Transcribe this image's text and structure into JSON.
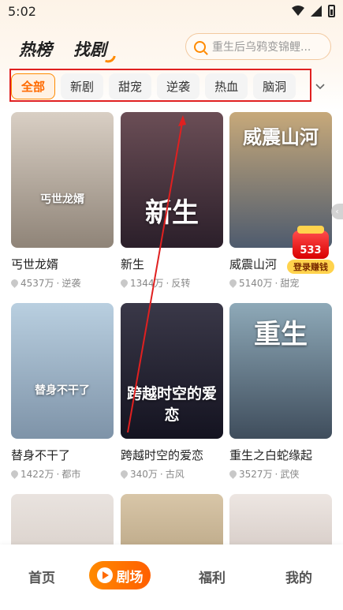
{
  "status_bar": {
    "time": "5:02"
  },
  "header": {
    "tab_hot": "热榜",
    "tab_find": "找剧",
    "search_placeholder": "重生后乌鸦变锦鲤..."
  },
  "categories": {
    "items": [
      "全部",
      "新剧",
      "甜宠",
      "逆袭",
      "热血",
      "脑洞"
    ],
    "active": "全部"
  },
  "dramas": [
    {
      "title": "丐世龙婿",
      "views": "4537万",
      "genre": "逆袭",
      "art": "丐世龙婿",
      "colors": [
        "#d9cfc4",
        "#8f8478"
      ]
    },
    {
      "title": "新生",
      "views": "1344万",
      "genre": "反转",
      "art": "新生",
      "colors": [
        "#6b4e56",
        "#2b1f2a"
      ]
    },
    {
      "title": "威震山河",
      "views": "5140万",
      "genre": "甜宠",
      "art": "威震山河",
      "colors": [
        "#c7a97a",
        "#4e5b6e"
      ]
    },
    {
      "title": "替身不干了",
      "views": "1422万",
      "genre": "都市",
      "art": "替身不干了",
      "colors": [
        "#b9cfe0",
        "#7e93a8"
      ]
    },
    {
      "title": "跨越时空的爱恋",
      "views": "340万",
      "genre": "古风",
      "art": "跨越时空的爱恋",
      "colors": [
        "#3a3848",
        "#141320"
      ]
    },
    {
      "title": "重生之白蛇缘起",
      "views": "3527万",
      "genre": "武侠",
      "art": "重生",
      "colors": [
        "#8ea9b8",
        "#3f4d5c"
      ]
    },
    {
      "title": "",
      "views": "",
      "genre": "",
      "art": "",
      "colors": [
        "#e9e3df",
        "#c9bdb4"
      ]
    },
    {
      "title": "",
      "views": "",
      "genre": "",
      "art": "",
      "colors": [
        "#d8c6a8",
        "#9c8662"
      ]
    },
    {
      "title": "",
      "views": "",
      "genre": "",
      "art": "",
      "colors": [
        "#ede6e2",
        "#b9aba4"
      ]
    }
  ],
  "bonus": {
    "amount": "533",
    "label": "登录赚钱"
  },
  "bottom_nav": {
    "home": "首页",
    "theater": "剧场",
    "welfare": "福利",
    "mine": "我的"
  },
  "colors": {
    "accent": "#ff8a00",
    "highlight": "#e02020"
  }
}
